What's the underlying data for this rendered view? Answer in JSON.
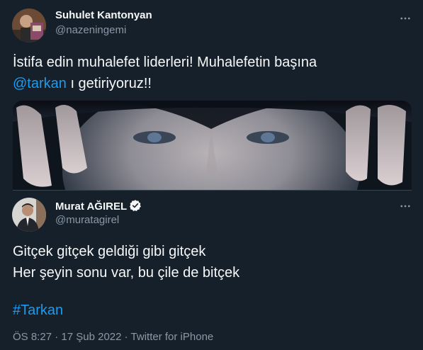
{
  "outer_tweet": {
    "display_name": "Suhulet Kantonyan",
    "handle": "@nazeningemi",
    "text_before": "İstifa edin muhalefet liderleri! Muhalefetin başına",
    "mention": "@tarkan",
    "text_after": " ı getiriyoruz!!",
    "more_icon": "more-dots-icon"
  },
  "quoted_tweet": {
    "display_name": "Murat AĞIREL",
    "handle": "@muratagirel",
    "verified_icon": "verified-badge-icon",
    "line1": "Gitçek gitçek geldiği gibi gitçek",
    "line2": "Her şeyin sonu var, bu çile de bitçek",
    "hashtag": "#Tarkan",
    "more_icon": "more-dots-icon"
  },
  "footer": {
    "time": "ÖS 8:27",
    "sep1": " · ",
    "date": "17 Şub 2022",
    "sep2": " · ",
    "source": "Twitter for iPhone"
  },
  "colors": {
    "background": "#15202b",
    "link": "#1d9bf0",
    "secondary_text": "#8b98a5",
    "primary_text": "#f7f9f9"
  }
}
